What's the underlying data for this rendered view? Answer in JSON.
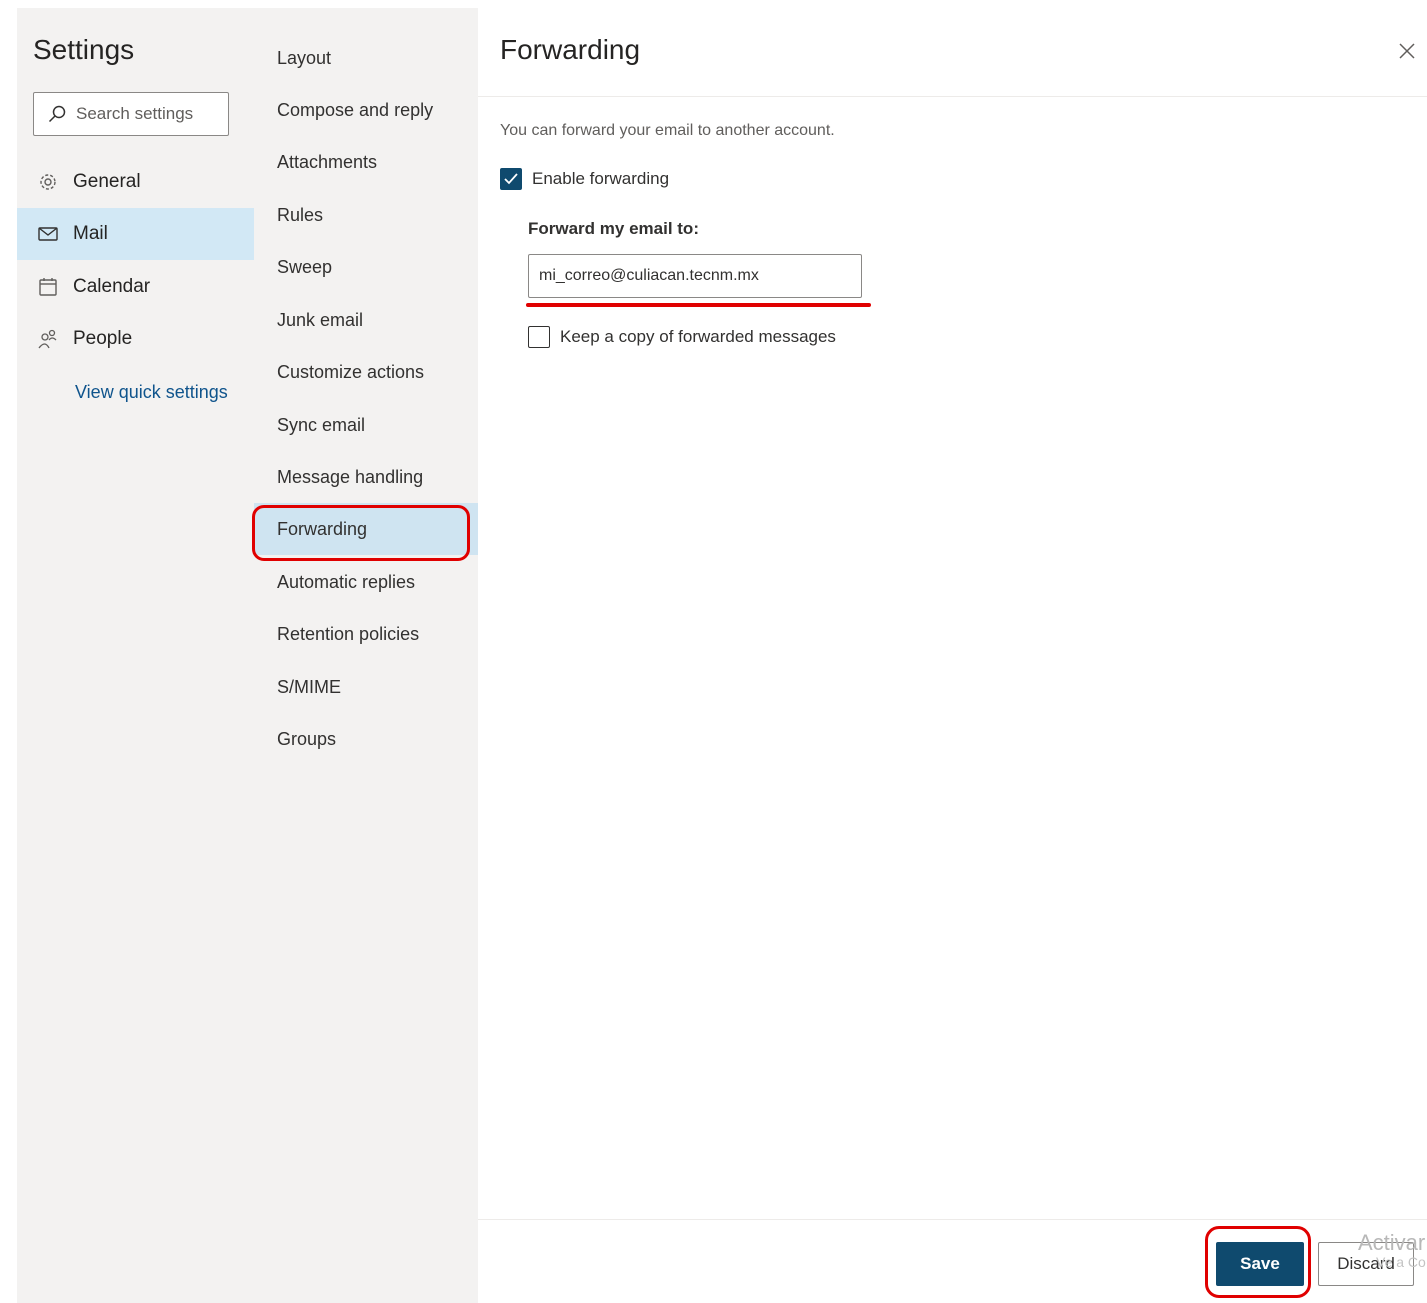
{
  "settings": {
    "title": "Settings",
    "search_placeholder": "Search settings",
    "nav": [
      {
        "label": "General",
        "icon": "gear-icon"
      },
      {
        "label": "Mail",
        "icon": "mail-icon",
        "selected": true
      },
      {
        "label": "Calendar",
        "icon": "calendar-icon"
      },
      {
        "label": "People",
        "icon": "people-icon"
      }
    ],
    "quick_settings_link": "View quick settings"
  },
  "mail_nav": {
    "items": [
      {
        "label": "Layout"
      },
      {
        "label": "Compose and reply"
      },
      {
        "label": "Attachments"
      },
      {
        "label": "Rules"
      },
      {
        "label": "Sweep"
      },
      {
        "label": "Junk email"
      },
      {
        "label": "Customize actions"
      },
      {
        "label": "Sync email"
      },
      {
        "label": "Message handling"
      },
      {
        "label": "Forwarding",
        "selected": true
      },
      {
        "label": "Automatic replies"
      },
      {
        "label": "Retention policies"
      },
      {
        "label": "S/MIME"
      },
      {
        "label": "Groups"
      }
    ]
  },
  "forwarding": {
    "title": "Forwarding",
    "intro": "You can forward your email to another account.",
    "enable_label": "Enable forwarding",
    "enable_checked": true,
    "forward_to_label": "Forward my email to:",
    "forward_to_value": "mi_correo@culiacan.tecnm.mx",
    "keep_copy_label": "Keep a copy of forwarded messages",
    "keep_copy_checked": false
  },
  "footer": {
    "save_label": "Save",
    "discard_label": "Discard"
  },
  "watermark": {
    "line1": "Activar",
    "line2": "Ve a Co"
  },
  "colors": {
    "accent": "#0f4a6e",
    "selected_bg": "#d2e8f5",
    "annotation": "#e00000"
  }
}
